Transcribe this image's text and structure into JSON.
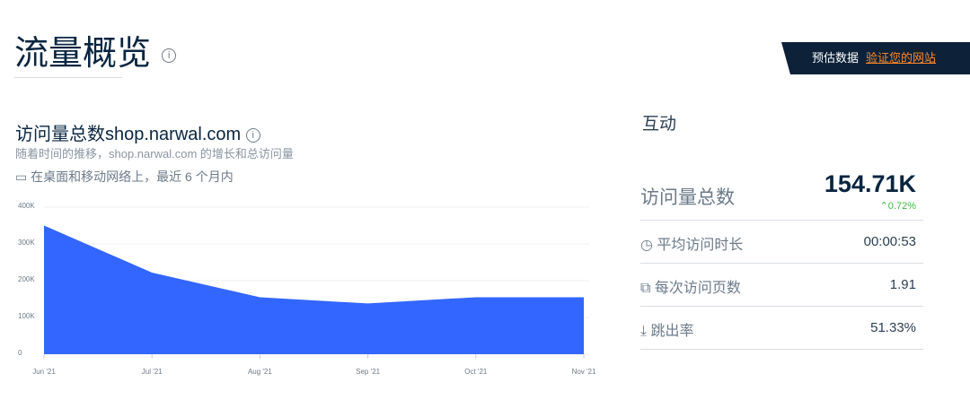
{
  "header": {
    "title": "流量概览",
    "info_icon": "i"
  },
  "banner": {
    "label": "预估数据",
    "link": "验证您的网站"
  },
  "section": {
    "title": "访问量总数shop.narwal.com",
    "subtitle": "随着时间的推移，shop.narwal.com 的增长和总访问量",
    "scope": "在桌面和移动网络上，最近 6 个月内"
  },
  "chart_data": {
    "type": "area",
    "categories": [
      "Jun '21",
      "Jul '21",
      "Aug '21",
      "Sep '21",
      "Oct '21",
      "Nov '21"
    ],
    "values": [
      350000,
      222000,
      155000,
      138000,
      155000,
      155000
    ],
    "yticks": [
      "0",
      "100K",
      "200K",
      "300K",
      "400K"
    ],
    "ylim": [
      0,
      400000
    ],
    "color": "#3366ff",
    "grid": true
  },
  "engagement": {
    "title": "互动",
    "total_label": "访问量总数",
    "total_value": "154.71K",
    "change": "0.72%",
    "change_color": "#3dbb3d",
    "metrics": [
      {
        "label": "平均访问时长",
        "value": "00:00:53",
        "icon": "stopwatch-icon"
      },
      {
        "label": "每次访问页数",
        "value": "1.91",
        "icon": "pages-icon"
      },
      {
        "label": "跳出率",
        "value": "51.33%",
        "icon": "bounce-icon"
      }
    ]
  }
}
